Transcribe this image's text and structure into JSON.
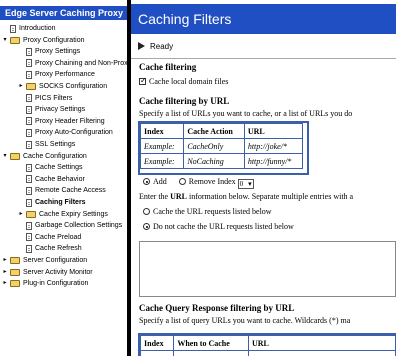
{
  "nav": {
    "header": "Edge Server Caching Proxy",
    "items": [
      {
        "label": "Introduction",
        "type": "doc",
        "indent": 0
      },
      {
        "label": "Proxy Configuration",
        "type": "folder",
        "indent": 0,
        "expanded": true
      },
      {
        "label": "Proxy Settings",
        "type": "doc",
        "indent": 1
      },
      {
        "label": "Proxy Chaining and Non-Proxy",
        "type": "doc",
        "indent": 1
      },
      {
        "label": "Proxy Performance",
        "type": "doc",
        "indent": 1
      },
      {
        "label": "SOCKS Configuration",
        "type": "folder",
        "indent": 1,
        "expanded": false
      },
      {
        "label": "PICS Filters",
        "type": "doc",
        "indent": 1
      },
      {
        "label": "Privacy Settings",
        "type": "doc",
        "indent": 1
      },
      {
        "label": "Proxy Header Filtering",
        "type": "doc",
        "indent": 1
      },
      {
        "label": "Proxy Auto-Configuration",
        "type": "doc",
        "indent": 1
      },
      {
        "label": "SSL Settings",
        "type": "doc",
        "indent": 1
      },
      {
        "label": "Cache Configuration",
        "type": "folder",
        "indent": 0,
        "expanded": true
      },
      {
        "label": "Cache Settings",
        "type": "doc",
        "indent": 1
      },
      {
        "label": "Cache Behavior",
        "type": "doc",
        "indent": 1
      },
      {
        "label": "Remote Cache Access",
        "type": "doc",
        "indent": 1
      },
      {
        "label": "Caching Filters",
        "type": "doc",
        "indent": 1,
        "active": true
      },
      {
        "label": "Cache Expiry Settings",
        "type": "folder",
        "indent": 1,
        "expanded": false
      },
      {
        "label": "Garbage Collection Settings",
        "type": "doc",
        "indent": 1
      },
      {
        "label": "Cache Preload",
        "type": "doc",
        "indent": 1
      },
      {
        "label": "Cache Refresh",
        "type": "doc",
        "indent": 1
      },
      {
        "label": "Server Configuration",
        "type": "folder",
        "indent": 0,
        "expanded": false
      },
      {
        "label": "Server Activity Monitor",
        "type": "folder",
        "indent": 0,
        "expanded": false
      },
      {
        "label": "Plug-in Configuration",
        "type": "folder",
        "indent": 0,
        "expanded": false
      }
    ]
  },
  "page": {
    "title": "Caching Filters",
    "status": "Ready",
    "section1_heading": "Cache filtering",
    "cache_local_label": "Cache local domain files",
    "section2_heading": "Cache filtering by URL",
    "section2_desc": "Specify a list of URLs you want to cache, or a list of URLs you do",
    "table1": {
      "headers": [
        "Index",
        "Cache Action",
        "URL"
      ],
      "rows": [
        [
          "Example:",
          "CacheOnly",
          "http://joke/*"
        ],
        [
          "Example:",
          "NoCaching",
          "http://funny/*"
        ]
      ]
    },
    "add_label": "Add",
    "remove_label": "Remove Index",
    "remove_index_value": "0",
    "enter_url_text_pre": "Enter the ",
    "enter_url_text_bold": "URL",
    "enter_url_text_post": " information below. Separate multiple entries with a",
    "option_cache": "Cache the URL requests listed below",
    "option_nocache": "Do not cache the URL requests listed below",
    "section3_heading": "Cache Query Response filtering by URL",
    "section3_desc": "Specify a list of query URLs you want to cache. Wildcards (*) ma",
    "table2": {
      "headers": [
        "Index",
        "When to Cache",
        "URL"
      ]
    }
  },
  "colors": {
    "accent": "#1f4fc2",
    "table_border": "#3b5fa8"
  }
}
